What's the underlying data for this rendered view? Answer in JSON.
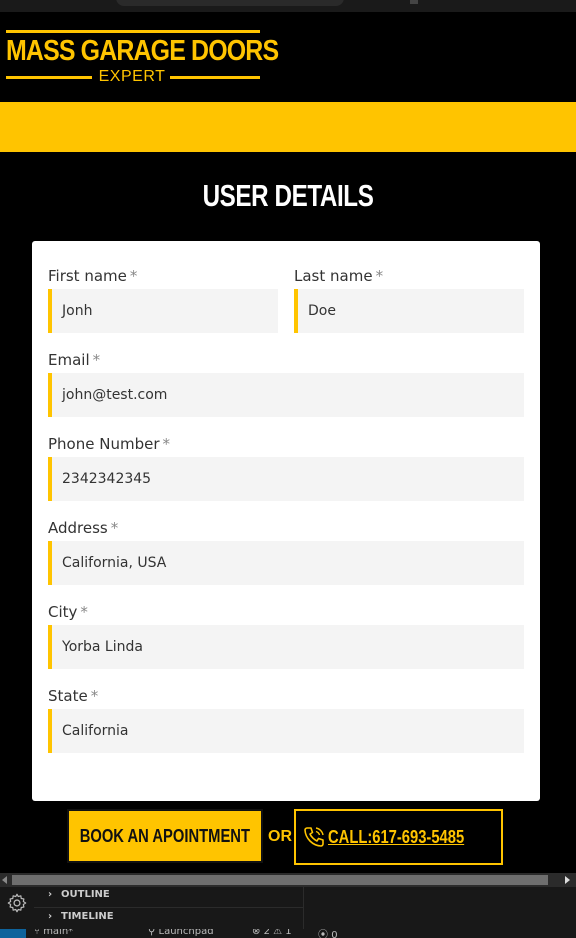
{
  "logo": {
    "main": "MASS GARAGE DOORS",
    "sub": "EXPERT"
  },
  "section_title": "USER DETAILS",
  "form": {
    "first_name": {
      "label": "First name",
      "required": "*",
      "value": "Jonh"
    },
    "last_name": {
      "label": "Last name",
      "required": "*",
      "value": "Doe"
    },
    "email": {
      "label": "Email",
      "required": "*",
      "value": "john@test.com"
    },
    "phone": {
      "label": "Phone Number",
      "required": "*",
      "value": "2342342345"
    },
    "address": {
      "label": "Address",
      "required": "*",
      "value": "California, USA"
    },
    "city": {
      "label": "City",
      "required": "*",
      "value": "Yorba Linda"
    },
    "state": {
      "label": "State",
      "required": "*",
      "value": "California"
    }
  },
  "cta": {
    "book_label": "BOOK AN APOINTMENT",
    "or_label": "OR",
    "call_label": "CALL:617-693-5485"
  },
  "editor": {
    "panel_items": [
      "OUTLINE",
      "TIMELINE"
    ],
    "status": {
      "branch": "main*",
      "launchpad": "Launchpad",
      "errors": "2",
      "warnings": "1",
      "ports": "0"
    }
  },
  "colors": {
    "accent": "#ffc400",
    "background": "#000000",
    "card": "#ffffff",
    "input_bg": "#f4f4f4"
  },
  "icons": [
    "phone-icon",
    "gear-icon",
    "chevron-right-icon"
  ]
}
